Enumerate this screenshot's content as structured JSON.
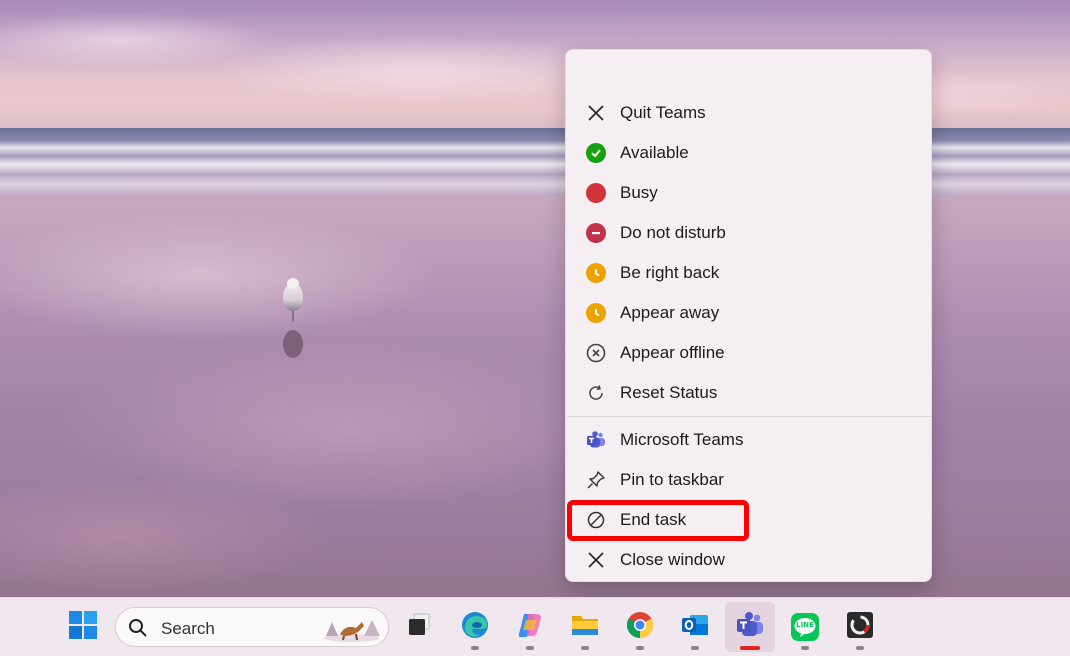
{
  "menu": {
    "items": [
      {
        "label": "Quit Teams",
        "icon": "close-icon"
      },
      {
        "label": "Available",
        "icon": "available-status-icon",
        "color": "#13a10e"
      },
      {
        "label": "Busy",
        "icon": "busy-status-icon",
        "color": "#d13438"
      },
      {
        "label": "Do not disturb",
        "icon": "do-not-disturb-icon",
        "color": "#c4314b"
      },
      {
        "label": "Be right back",
        "icon": "be-right-back-icon",
        "color": "#eaa300"
      },
      {
        "label": "Appear away",
        "icon": "appear-away-icon",
        "color": "#eaa300"
      },
      {
        "label": "Appear offline",
        "icon": "appear-offline-icon"
      },
      {
        "label": "Reset Status",
        "icon": "reset-icon"
      },
      {
        "label": "Microsoft Teams",
        "icon": "teams-icon"
      },
      {
        "label": "Pin to taskbar",
        "icon": "pin-icon"
      },
      {
        "label": "End task",
        "icon": "end-task-icon",
        "highlighted": true
      },
      {
        "label": "Close window",
        "icon": "close-icon"
      }
    ]
  },
  "taskbar": {
    "search_placeholder": "Search",
    "apps": [
      {
        "name": "windows-start",
        "icon": "windows-logo-icon"
      },
      {
        "name": "task-view",
        "icon": "task-view-icon"
      },
      {
        "name": "edge",
        "icon": "edge-icon",
        "running": true
      },
      {
        "name": "copilot",
        "icon": "copilot-icon",
        "running": true
      },
      {
        "name": "file-explorer",
        "icon": "folder-icon",
        "running": true
      },
      {
        "name": "chrome",
        "icon": "chrome-icon",
        "running": true
      },
      {
        "name": "outlook",
        "icon": "outlook-icon",
        "running": true
      },
      {
        "name": "teams",
        "icon": "teams-icon",
        "running": true,
        "active": true
      },
      {
        "name": "line",
        "icon": "line-icon",
        "running": true
      },
      {
        "name": "recorder",
        "icon": "recorder-icon",
        "running": true
      }
    ],
    "line_badge_text": "LINE"
  },
  "colors": {
    "highlight": "#ff0000",
    "menu_bg": "#f5eff3",
    "taskbar_bg": "#f1e7ee"
  }
}
